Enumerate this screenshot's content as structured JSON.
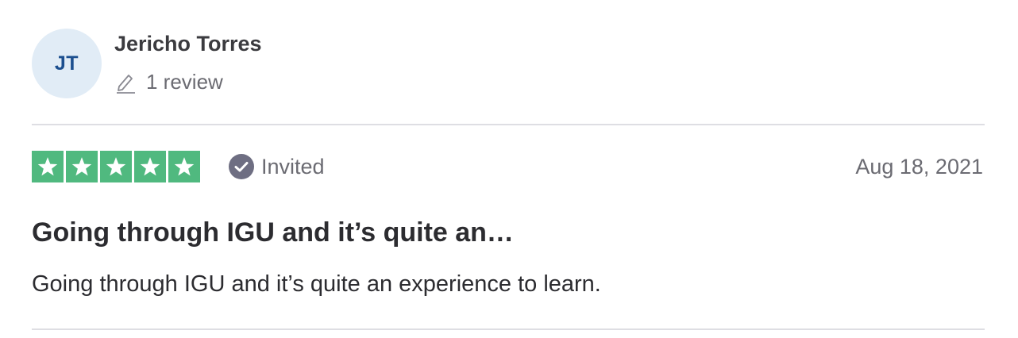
{
  "reviewer": {
    "initials": "JT",
    "name": "Jericho Torres",
    "review_count": "1 review",
    "avatar_bg": "#e1ecf6",
    "avatar_text_color": "#1c4f8f"
  },
  "review": {
    "rating": 5,
    "rating_max": 5,
    "star_color": "#50b97f",
    "status": "Invited",
    "date": "Aug 18, 2021",
    "title": "Going through IGU and it’s quite an…",
    "body": "Going through IGU and it’s quite an experience to learn."
  },
  "icons": {
    "edit": "pencil-icon",
    "verified": "check-circle-icon",
    "rating": "star-icon"
  }
}
